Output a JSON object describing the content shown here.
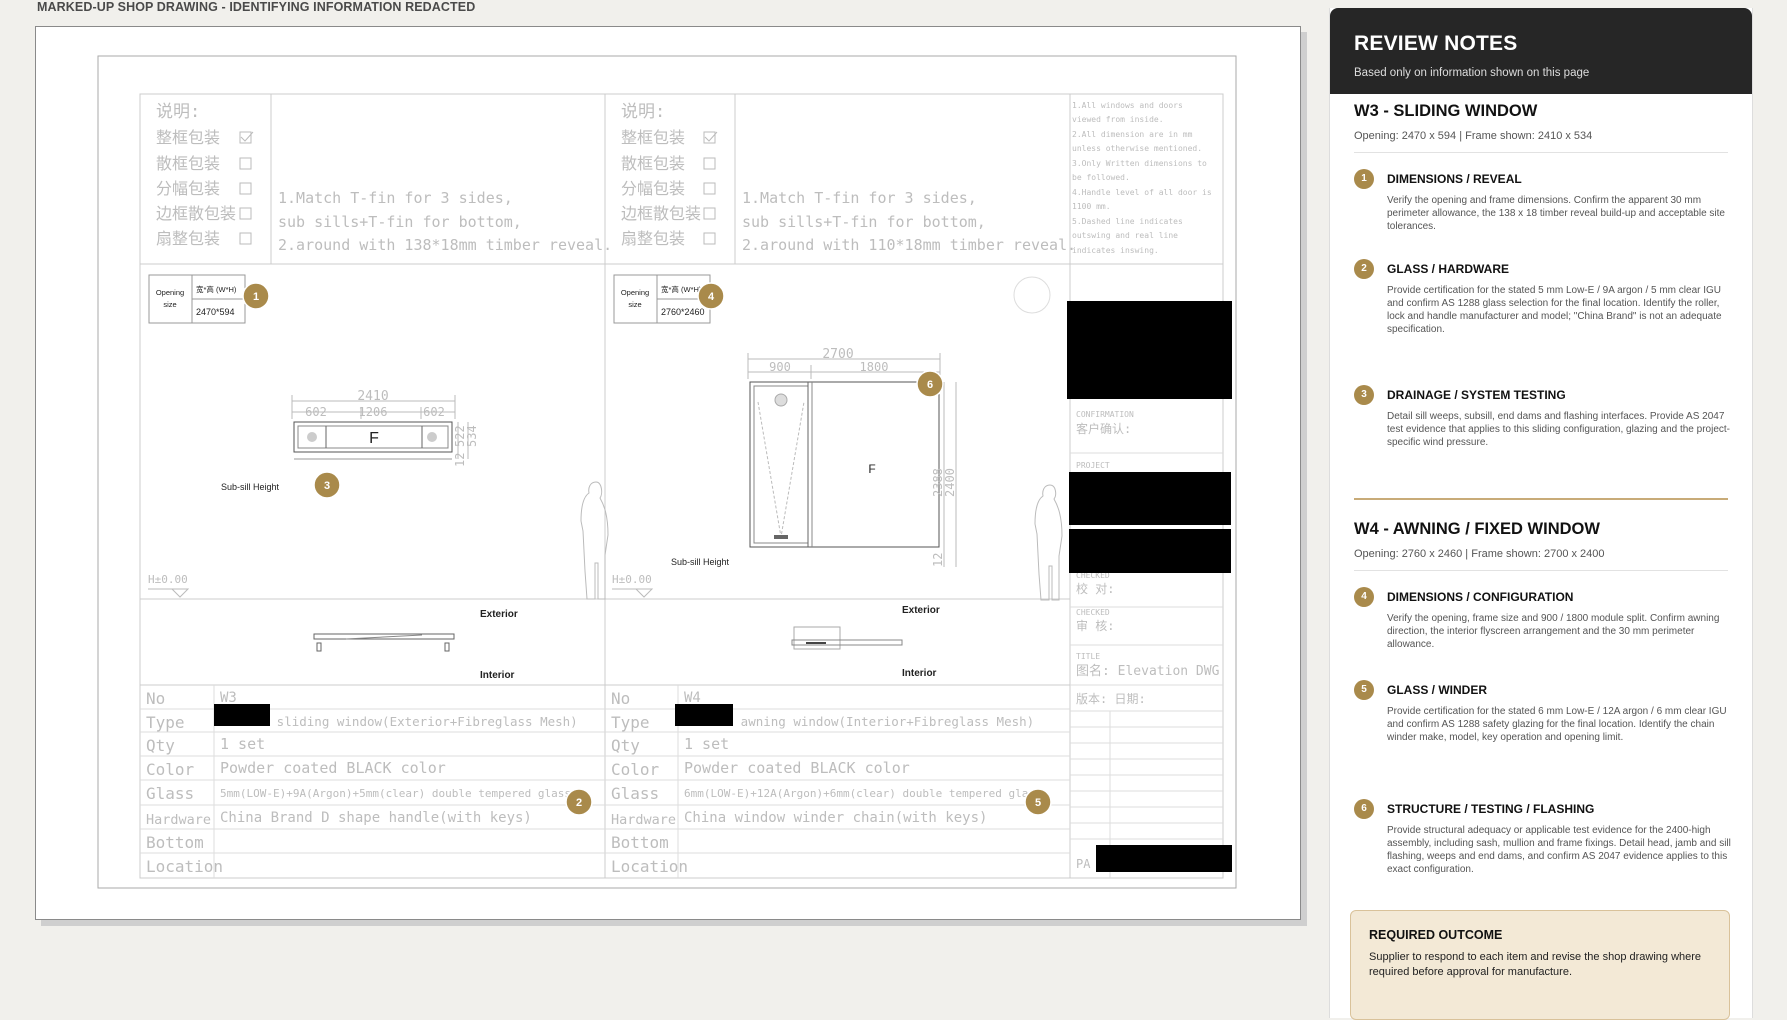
{
  "caption": "MARKED-UP SHOP DRAWING - IDENTIFYING INFORMATION REDACTED",
  "drawing": {
    "notes_header": "说明:",
    "pack_options": [
      "整框包装",
      "散框包装",
      "分幅包装",
      "边框散包装",
      "扇整包装"
    ],
    "w3_notes": [
      "1.Match T-fin for 3 sides,",
      "sub sills+T-fin for bottom,",
      "2.around with 138*18mm timber reveal."
    ],
    "w4_notes": [
      "1.Match T-fin for 3 sides,",
      "sub sills+T-fin for bottom,",
      "2.around with 110*18mm timber reveal."
    ],
    "general_notes": [
      "1.All windows and doors",
      "viewed from inside.",
      "2.All dimension are in mm",
      "unless otherwise mentioned.",
      "3.Only Written dimensions to",
      "be followed.",
      "4.Handle level of all door is",
      "1100 mm.",
      "5.Dashed line indicates",
      "outswing and real line",
      "indicates inswing."
    ],
    "opening_label": "Opening size",
    "opening_header": "宽*高 (W*H)",
    "w3_opening": "2470*594",
    "w4_opening": "2760*2460",
    "w3_dims": {
      "overall": "2410",
      "left": "602",
      "mid": "1206",
      "right": "602",
      "h1": "522",
      "h2": "534",
      "sill": "12"
    },
    "w4_dims": {
      "overall": "2700",
      "left": "900",
      "right": "1800",
      "h1": "2388",
      "h2": "2400",
      "sill": "12"
    },
    "fixed_label": "F",
    "subsill_label": "Sub-sill Height",
    "level_label": "H±0.00",
    "exterior_label": "Exterior",
    "interior_label": "Interior",
    "row_labels": [
      "No",
      "Type",
      "Qty",
      "Color",
      "Glass",
      "Hardware",
      "Bottom",
      "Location"
    ],
    "w3_rows": [
      "W3",
      "series sliding window(Exterior+Fibreglass Mesh)",
      "1 set",
      "Powder coated BLACK color",
      "5mm(LOW-E)+9A(Argon)+5mm(clear) double tempered glass",
      "China Brand D shape handle(with keys)",
      "",
      ""
    ],
    "w4_rows": [
      "W4",
      "series awning window(Interior+Fibreglass Mesh)",
      "1 set",
      "Powder coated BLACK color",
      "6mm(LOW-E)+12A(Argon)+6mm(clear) double tempered glass",
      "China window winder chain(with keys)",
      "",
      ""
    ],
    "title_block": {
      "confirmation_en": "CONFIRMATION",
      "confirmation_cn": "客户确认:",
      "project_en": "PROJECT",
      "checked_en": "CHECKED",
      "checked_cn": "校 对:",
      "checked2_en": "CHECKED",
      "checked2_cn": "审 核:",
      "title_en": "TITLE",
      "title_cn": "图名: Elevation DWG",
      "version_cn": "版本: 日期:",
      "page_abbr": "PA"
    },
    "markers": [
      "1",
      "2",
      "3",
      "4",
      "5",
      "6"
    ]
  },
  "panel": {
    "title": "REVIEW NOTES",
    "subtitle": "Based only on information shown on this page",
    "w3": {
      "title": "W3 - SLIDING WINDOW",
      "sub": "Opening: 2470 x 594 | Frame shown: 2410 x 534",
      "items": [
        {
          "n": "1",
          "title": "DIMENSIONS / REVEAL",
          "body": "Verify the opening and frame dimensions. Confirm the apparent 30 mm perimeter allowance, the 138 x 18 timber reveal build-up and acceptable site tolerances."
        },
        {
          "n": "2",
          "title": "GLASS / HARDWARE",
          "body": "Provide certification for the stated 5 mm Low-E / 9A argon / 5 mm clear IGU and confirm AS 1288 glass selection for the final location. Identify the roller, lock and handle manufacturer and model; \"China Brand\" is not an adequate specification."
        },
        {
          "n": "3",
          "title": "DRAINAGE / SYSTEM TESTING",
          "body": "Detail sill weeps, subsill, end dams and flashing interfaces. Provide AS 2047 test evidence that applies to this sliding configuration, glazing and the project-specific wind pressure."
        }
      ]
    },
    "w4": {
      "title": "W4 - AWNING / FIXED WINDOW",
      "sub": "Opening: 2760 x 2460 | Frame shown: 2700 x 2400",
      "items": [
        {
          "n": "4",
          "title": "DIMENSIONS / CONFIGURATION",
          "body": "Verify the opening, frame size and 900 / 1800 module split. Confirm awning direction, the interior flyscreen arrangement and the 30 mm perimeter allowance."
        },
        {
          "n": "5",
          "title": "GLASS / WINDER",
          "body": "Provide certification for the stated 6 mm Low-E / 12A argon / 6 mm clear IGU and confirm AS 1288 safety glazing for the final location. Identify the chain winder make, model, key operation and opening limit."
        },
        {
          "n": "6",
          "title": "STRUCTURE / TESTING / FLASHING",
          "body": "Provide structural adequacy or applicable test evidence for the 2400-high assembly, including sash, mullion and frame fixings. Detail head, jamb and sill flashing, weeps and end dams, and confirm AS 2047 evidence applies to this exact configuration."
        }
      ]
    },
    "outcome": {
      "title": "REQUIRED OUTCOME",
      "body": "Supplier to respond to each item and revise the shop drawing where required before approval for manufacture."
    }
  }
}
